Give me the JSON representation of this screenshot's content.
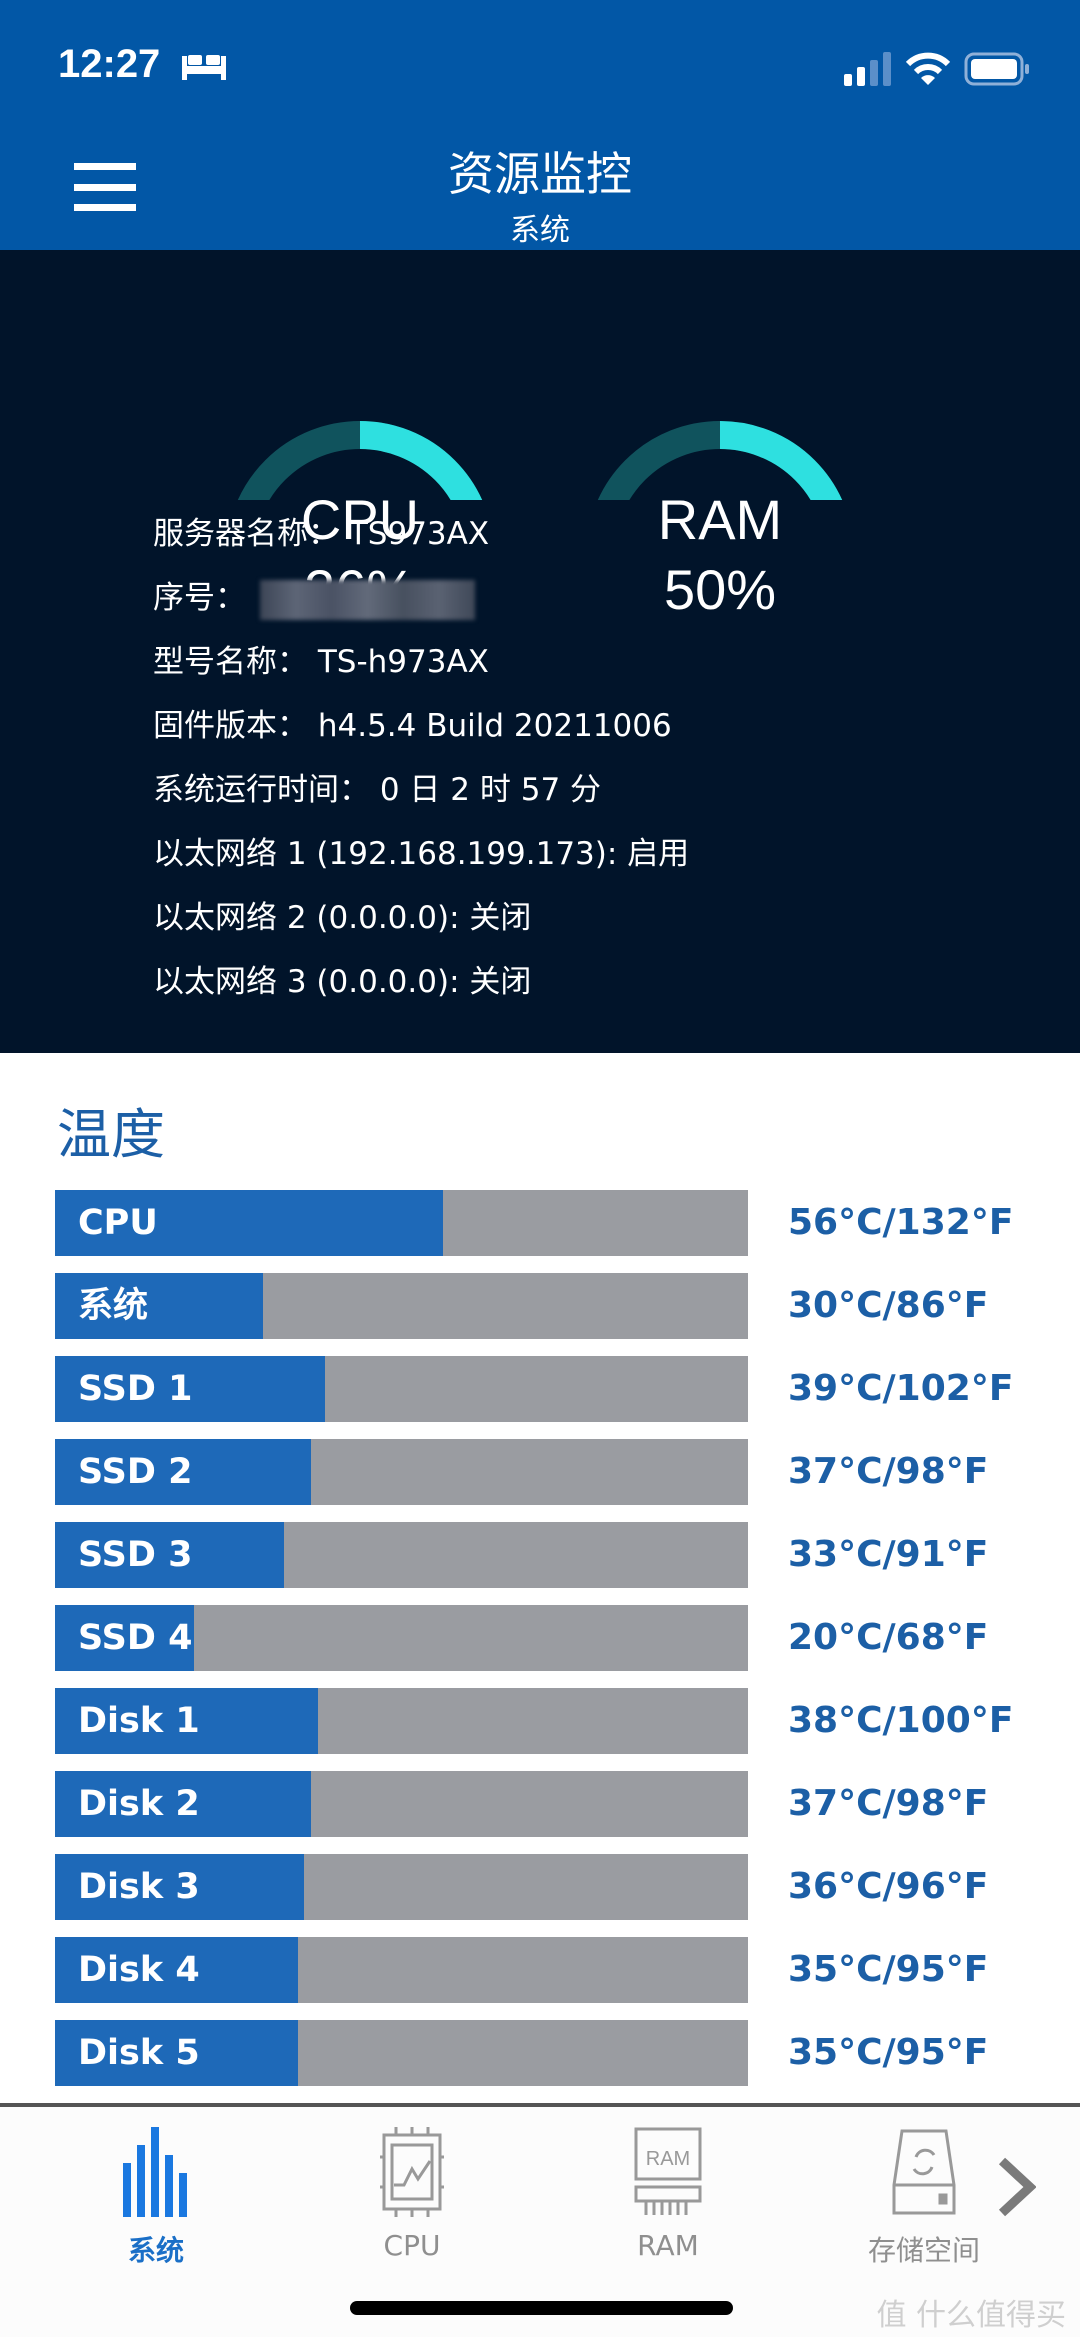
{
  "status_bar": {
    "time": "12:27",
    "icons": [
      "bed-icon",
      "signal-icon",
      "wifi-icon",
      "battery-icon"
    ]
  },
  "header": {
    "title": "资源监控",
    "subtitle": "系统",
    "menu_icon": "hamburger-menu-icon"
  },
  "gauges": [
    {
      "label": "CPU",
      "value_text": "26%",
      "percent": 26
    },
    {
      "label": "RAM",
      "value_text": "50%",
      "percent": 50
    }
  ],
  "gauge_colors": {
    "track": "#10535d",
    "progress": "#2ee0e0"
  },
  "info": [
    {
      "label": "服务器名称：",
      "value": "TS973AX"
    },
    {
      "label": "序号：",
      "value": null,
      "redacted": true
    },
    {
      "label": "型号名称：",
      "value": "TS-h973AX"
    },
    {
      "label": "固件版本：",
      "value": "h4.5.4 Build 20211006"
    },
    {
      "label": "系统运行时间：",
      "value": "0 日 2 时 57 分"
    },
    {
      "label": "以太网络 1 (192.168.199.173):",
      "value": "启用"
    },
    {
      "label": "以太网络 2 (0.0.0.0):",
      "value": "关闭"
    },
    {
      "label": "以太网络 3 (0.0.0.0):",
      "value": "关闭"
    }
  ],
  "temperature": {
    "title": "温度",
    "items": [
      {
        "label": "CPU",
        "celsius": 56,
        "text": "56°C/132°F"
      },
      {
        "label": "系统",
        "celsius": 30,
        "text": "30°C/86°F"
      },
      {
        "label": "SSD 1",
        "celsius": 39,
        "text": "39°C/102°F"
      },
      {
        "label": "SSD 2",
        "celsius": 37,
        "text": "37°C/98°F"
      },
      {
        "label": "SSD 3",
        "celsius": 33,
        "text": "33°C/91°F"
      },
      {
        "label": "SSD 4",
        "celsius": 20,
        "text": "20°C/68°F"
      },
      {
        "label": "Disk 1",
        "celsius": 38,
        "text": "38°C/100°F"
      },
      {
        "label": "Disk 2",
        "celsius": 37,
        "text": "37°C/98°F"
      },
      {
        "label": "Disk 3",
        "celsius": 36,
        "text": "36°C/96°F"
      },
      {
        "label": "Disk 4",
        "celsius": 35,
        "text": "35°C/95°F"
      },
      {
        "label": "Disk 5",
        "celsius": 35,
        "text": "35°C/95°F"
      }
    ]
  },
  "tabs": [
    {
      "label": "系统",
      "icon": "bar-chart-icon",
      "active": true
    },
    {
      "label": "CPU",
      "icon": "cpu-chip-icon",
      "active": false
    },
    {
      "label": "RAM",
      "icon": "ram-module-icon",
      "active": false,
      "icon_text": "RAM"
    },
    {
      "label": "存储空间",
      "icon": "storage-drive-icon",
      "active": false
    }
  ],
  "watermark": "值 什么值得买"
}
